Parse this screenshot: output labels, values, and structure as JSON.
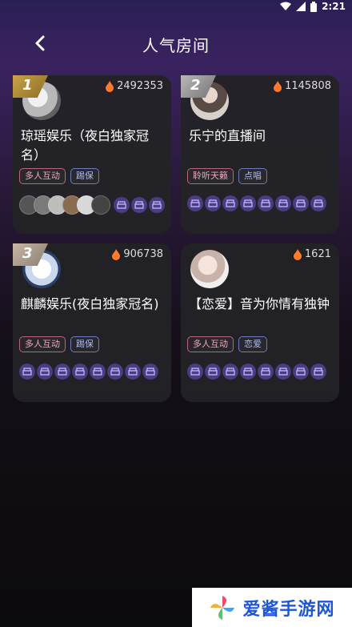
{
  "status": {
    "time": "2:21"
  },
  "header": {
    "title": "人气房间"
  },
  "rooms": [
    {
      "rank": "1",
      "heat": "2492353",
      "name": "琼瑶娱乐（夜白独家冠名）",
      "tags": [
        "多人互动",
        "踢保"
      ]
    },
    {
      "rank": "2",
      "heat": "1145808",
      "name": "乐宁的直播间",
      "tags": [
        "聆听天籁",
        "点唱"
      ]
    },
    {
      "rank": "3",
      "heat": "906738",
      "name": "麒麟娱乐(夜白独家冠名)",
      "tags": [
        "多人互动",
        "踢保"
      ]
    },
    {
      "rank": "",
      "heat": "1621",
      "name": "【恋爱】音为你情有独钟",
      "tags": [
        "多人互动",
        "恋爱"
      ]
    }
  ],
  "watermark": {
    "text": "爱酱手游网"
  },
  "colors": {
    "accent": "#4b3c83",
    "flame": "#ff7a2c"
  }
}
